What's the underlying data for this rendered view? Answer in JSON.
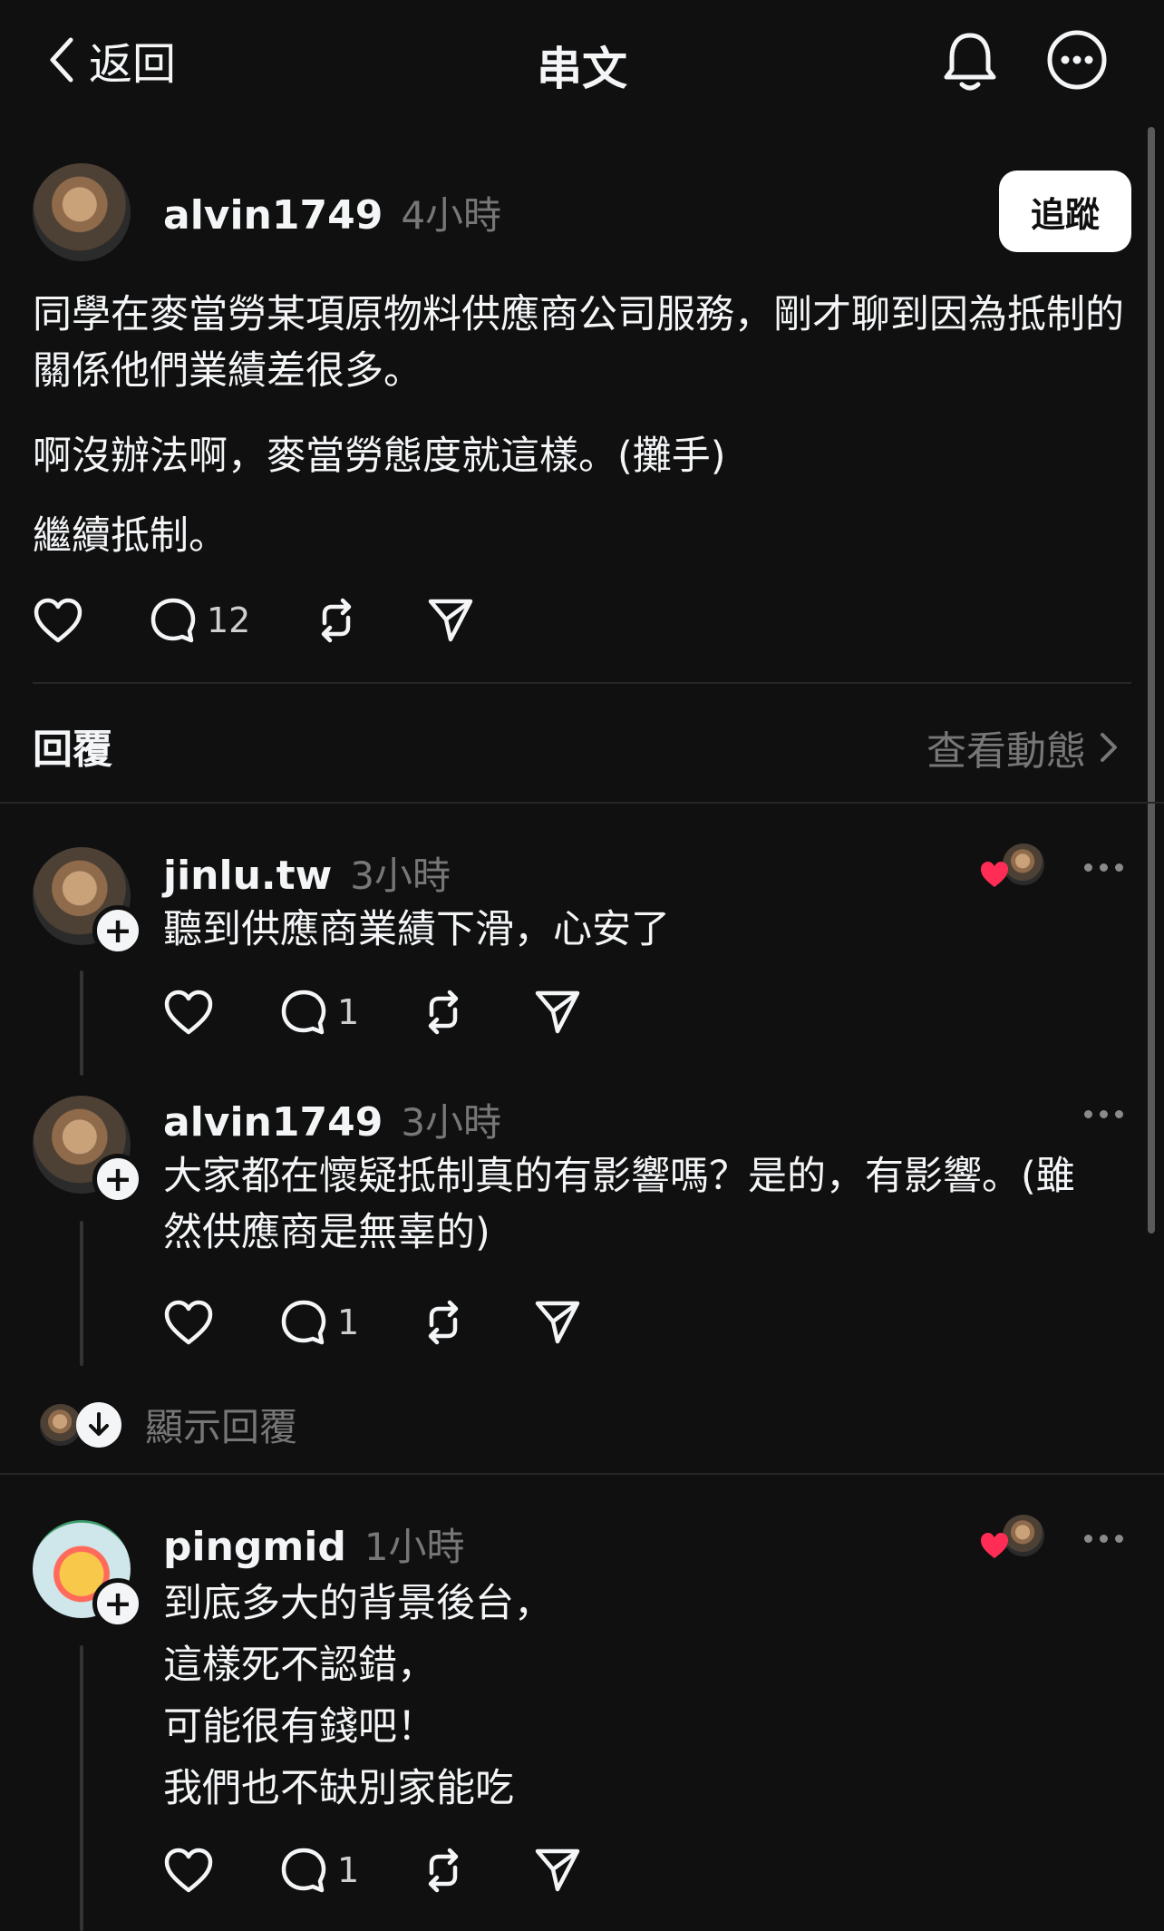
{
  "header": {
    "back_label": "返回",
    "title": "串文",
    "icons": [
      "back-chevron-icon",
      "bell-icon",
      "more-circle-icon"
    ]
  },
  "post": {
    "username": "alvin1749",
    "time": "4小時",
    "follow_label": "追蹤",
    "paragraphs": [
      "同學在麥當勞某項原物料供應商公司服務，剛才聊到因為抵制的關係他們業績差很多。",
      "啊沒辦法啊，麥當勞態度就這樣。(攤手)",
      "繼續抵制。"
    ],
    "reply_count": "12"
  },
  "replies_section": {
    "title": "回覆",
    "view_activity": "查看動態"
  },
  "replies": [
    {
      "username": "jinlu.tw",
      "time": "3小時",
      "text": "聽到供應商業績下滑，心安了",
      "reply_count": "1",
      "liked_by_author": true
    },
    {
      "username": "alvin1749",
      "time": "3小時",
      "text": "大家都在懷疑抵制真的有影響嗎？是的，有影響。(雖然供應商是無辜的)",
      "reply_count": "1",
      "liked_by_author": false
    },
    {
      "username": "pingmid",
      "time": "1小時",
      "text": "到底多大的背景後台，\n這樣死不認錯，\n可能很有錢吧！\n我們也不缺別家能吃",
      "reply_count": "1",
      "liked_by_author": true
    }
  ],
  "show_replies_label": "顯示回覆",
  "colors": {
    "background": "#101010",
    "text": "#f3f5f7",
    "muted": "#777777",
    "divider": "#262626",
    "heart": "#ff2d55"
  }
}
